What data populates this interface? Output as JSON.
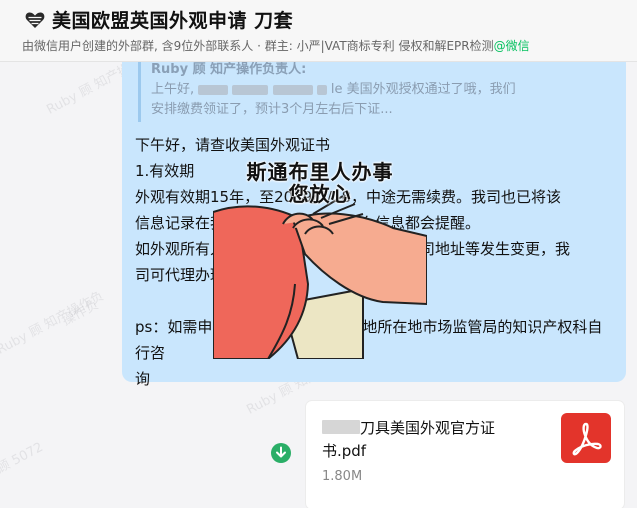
{
  "header": {
    "title": "美国欧盟英国外观申请 刀套",
    "subtitle": "由微信用户创建的外部群, 含9位外部联系人 · 群主: 小严|VAT商标专利 侵权和解EPR检测",
    "subtitle_tag": "@微信",
    "icon": "heart-icon"
  },
  "watermarks": [
    "Ruby 顾 知产操作负",
    "Ruby 顾 知产操作负",
    "Ruby 顾 知产操作负",
    "Ruby 顾 知产操作负",
    "顾 5072",
    "操作负"
  ],
  "message": {
    "quote_head": "Ruby 顾 知产操作负责人:",
    "quote_line1_prefix": "上午好,",
    "quote_line1_suffix": "le 美国外观授权通过了哦，我们",
    "quote_line2": "安排缴费领证了，预计3个月左右后下证...",
    "lines": [
      "下午好，请查收美国外观证书",
      "1.有效期",
      "外观有效期15年，至2039/7/18，中途无需续费。我司也已将该",
      "信息记录在我司系统中，中途有什么信息都会提醒。",
      "如外观所有人的名称或地址等发生变更，公司地址等发生变更，我",
      "司可代理办理变更。",
      "",
      "ps：如需申请外观维权，需要向当地所在地市场监管局的知识产权科自行咨",
      "询"
    ]
  },
  "meme": {
    "caption_line1": "斯通布里人办事",
    "caption_line2": "您放心"
  },
  "file": {
    "name_line1": "刀具美国外观官方证",
    "name_line2": "书.pdf",
    "size": "1.80M",
    "icon": "pdf-icon",
    "download_icon": "download-icon",
    "accent": "#e3342b"
  }
}
